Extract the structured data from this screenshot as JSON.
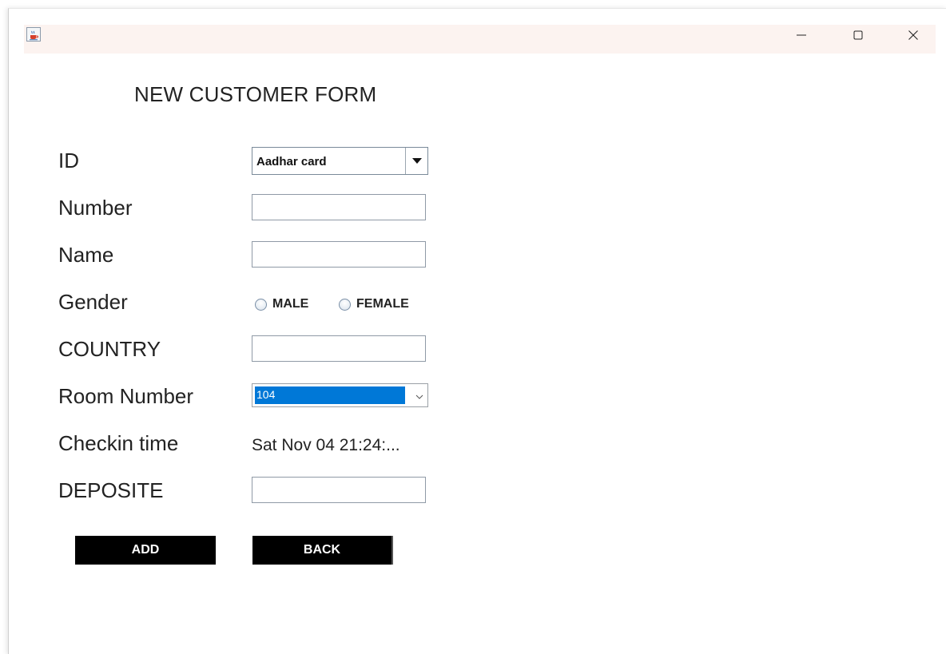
{
  "window": {
    "minimize_symbol": "—",
    "close_symbol": "✕",
    "icons": {
      "app": "java-cup-icon",
      "minimize": "minimize-icon",
      "maximize": "maximize-icon",
      "close": "close-icon"
    }
  },
  "form": {
    "title": "NEW CUSTOMER FORM",
    "labels": {
      "id": "ID",
      "number": "Number",
      "name": "Name",
      "gender": "Gender",
      "country": "COUNTRY",
      "room_number": "Room Number",
      "checkin_time": "Checkin time",
      "deposite": "DEPOSITE"
    },
    "id_select": {
      "selected": "Aadhar card"
    },
    "inputs": {
      "number": "",
      "name": "",
      "country": "",
      "deposite": ""
    },
    "gender_options": {
      "male": "MALE",
      "female": "FEMALE"
    },
    "room_select": {
      "selected": "104"
    },
    "checkin_value": "Sat Nov 04 21:24:...",
    "buttons": {
      "add": "ADD",
      "back": "BACK"
    }
  },
  "colors": {
    "titlebar_bg": "#fcf3f0",
    "selection_blue": "#0078d7",
    "button_bg": "#000000",
    "button_text": "#ffffff"
  }
}
